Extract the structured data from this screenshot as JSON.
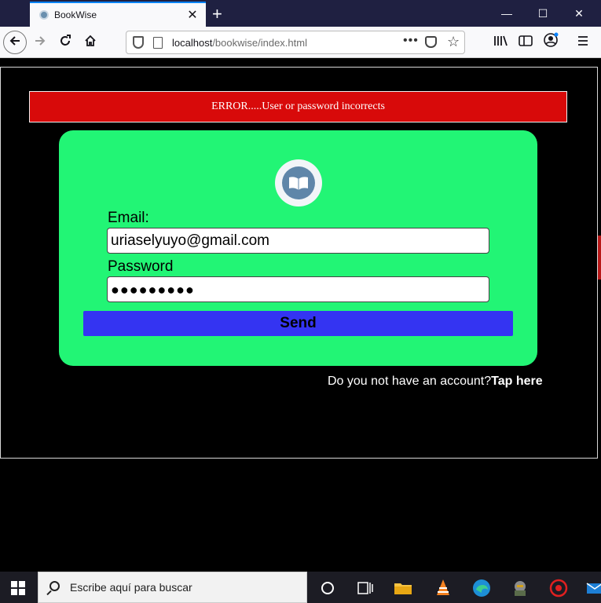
{
  "browser": {
    "tab_title": "BookWise",
    "tab_close": "✕",
    "new_tab": "+",
    "window_controls": {
      "minimize": "—",
      "maximize": "☐",
      "close": "✕"
    },
    "url_host": "localhost",
    "url_path": "/bookwise/index.html",
    "url_menu": "•••"
  },
  "page": {
    "error_message": "ERROR.....User or password incorrects",
    "email_label": "Email:",
    "email_value": "uriaselyuyo@gmail.com",
    "password_label": "Password",
    "password_value": "●●●●●●●●●",
    "send_label": "Send",
    "signup_prompt": "Do you not have an account?",
    "signup_link": "Tap here",
    "logo_icon": "book-icon",
    "colors": {
      "card": "#22f575",
      "error": "#d80a0a",
      "button": "#3434f2",
      "background": "#000000"
    }
  },
  "taskbar": {
    "search_placeholder": "Escribe aquí para buscar"
  }
}
